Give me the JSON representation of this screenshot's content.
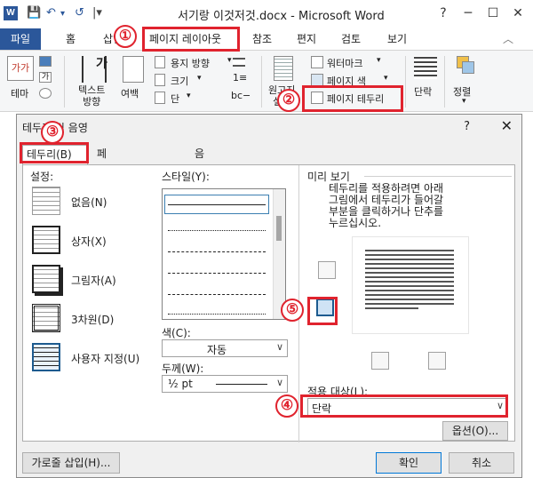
{
  "window": {
    "app_letter": "W",
    "title": "서기랑 이것저것.docx - Microsoft Word",
    "qat": [
      "💾",
      "↶",
      "▾",
      "↺",
      "|▾"
    ],
    "controls": [
      "?",
      "─",
      "☐",
      "✕"
    ]
  },
  "tabs": {
    "file": "파일",
    "items": [
      "홈",
      "삽입",
      "페이지 레이아웃",
      "참조",
      "편지",
      "검토",
      "보기"
    ],
    "collapse": "︿"
  },
  "ribbon": {
    "theme": "테마",
    "text_direction": "텍스트\n방향",
    "margins": "여백",
    "paper_orientation": "용지 방향",
    "size": "크기",
    "columns": "단",
    "manuscript": "원고지\n설정",
    "watermark": "워터마크",
    "page_color": "페이지 색",
    "page_borders": "페이지 테두리",
    "paragraph": "단락",
    "arrange": "정렬"
  },
  "badges": [
    "①",
    "②",
    "③",
    "④",
    "⑤"
  ],
  "dialog": {
    "title": "테두리 및 음영",
    "help": "?",
    "close": "✕",
    "tabs": [
      "테두리(B)",
      "페이지 테두리(P)",
      "음영(S)"
    ],
    "setting_label": "설정:",
    "settings": [
      "없음(N)",
      "상자(X)",
      "그림자(A)",
      "3차원(D)",
      "사용자 지정(U)"
    ],
    "style_label": "스타일(Y):",
    "color_label": "색(C):",
    "color_value": "자동",
    "width_label": "두께(W):",
    "width_value": "½ pt",
    "preview_label": "미리 보기",
    "preview_hint": "테두리를 적용하려면 아래\n그림에서 테두리가 들어갈\n부분을 클릭하거나 단추를\n누르십시오.",
    "apply_label": "적용 대상(L):",
    "apply_value": "단락",
    "options_button": "옵션(O)...",
    "horizontal_line_button": "가로줄 삽입(H)...",
    "ok_button": "확인",
    "cancel_button": "취소"
  }
}
